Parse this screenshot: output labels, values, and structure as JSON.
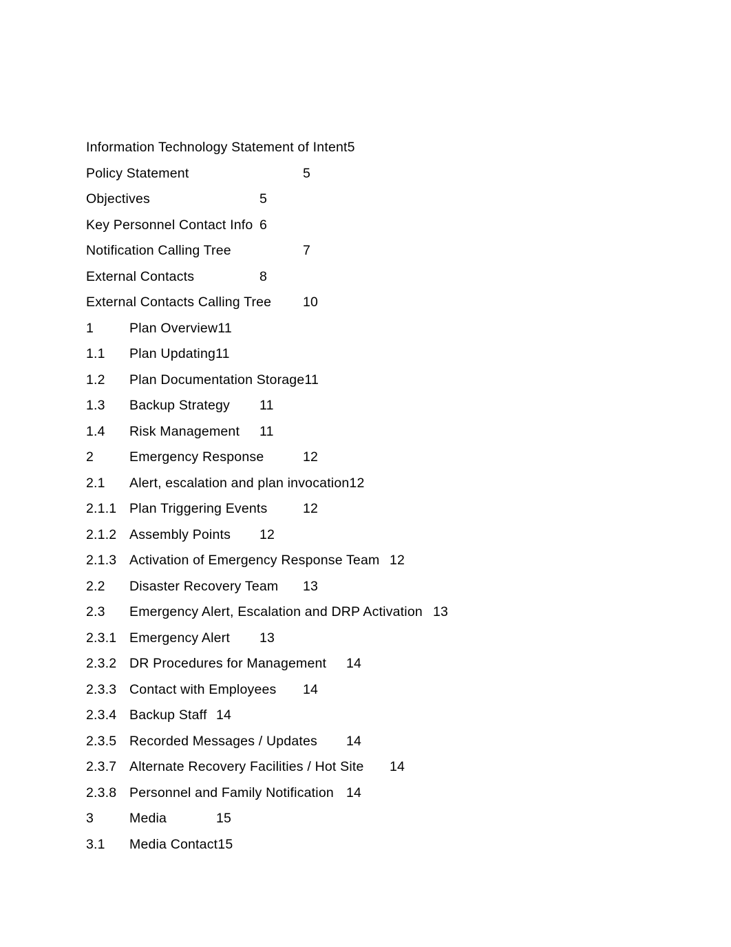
{
  "document": {
    "kind": "table-of-contents",
    "text_color": "#000000",
    "background_color": "#ffffff"
  },
  "toc": {
    "entries": [
      {
        "number": "",
        "title": "Information Technology Statement of Intent",
        "page": "5",
        "stop": "t6"
      },
      {
        "number": "",
        "title": "Policy Statement",
        "page": "5",
        "stop": "t5"
      },
      {
        "number": "",
        "title": "Objectives",
        "page": "5",
        "stop": "t4"
      },
      {
        "number": "",
        "title": "Key Personnel Contact Info",
        "page": "6",
        "stop": "t4"
      },
      {
        "number": "",
        "title": "Notification Calling Tree",
        "page": "7",
        "stop": "t5"
      },
      {
        "number": "",
        "title": "External Contacts",
        "page": "8",
        "stop": "t4"
      },
      {
        "number": "",
        "title": "External Contacts Calling Tree",
        "page": "10",
        "stop": "t5"
      },
      {
        "number": "1",
        "title": "Plan Overview",
        "page": "11",
        "stop": "t0"
      },
      {
        "number": "1.1",
        "title": "Plan Updating",
        "page": "11",
        "stop": "t0"
      },
      {
        "number": "1.2",
        "title": "Plan Documentation Storage",
        "page": "11",
        "stop": "t0"
      },
      {
        "number": "1.3",
        "title": "Backup Strategy",
        "page": "11",
        "stop": "t3"
      },
      {
        "number": "1.4",
        "title": "Risk Management",
        "page": "11",
        "stop": "t3"
      },
      {
        "number": "2",
        "title": "Emergency Response",
        "page": "12",
        "stop": "t4"
      },
      {
        "number": "2.1",
        "title": "Alert, escalation and plan invocation",
        "page": "12",
        "stop": "t0"
      },
      {
        "number": "2.1.1",
        "title": "Plan Triggering Events",
        "page": "12",
        "stop": "t4"
      },
      {
        "number": "2.1.2",
        "title": "Assembly Points",
        "page": "12",
        "stop": "t3"
      },
      {
        "number": "2.1.3",
        "title": "Activation of Emergency Response Team",
        "page": "12",
        "stop": "t6"
      },
      {
        "number": "2.2",
        "title": "Disaster Recovery Team",
        "page": "13",
        "stop": "t4"
      },
      {
        "number": "2.3",
        "title": "Emergency Alert, Escalation and DRP Activation",
        "page": "13",
        "stop": "t7"
      },
      {
        "number": "2.3.1",
        "title": "Emergency Alert",
        "page": "13",
        "stop": "t3"
      },
      {
        "number": "2.3.2",
        "title": "DR Procedures for Management",
        "page": "14",
        "stop": "t5"
      },
      {
        "number": "2.3.3",
        "title": "Contact with Employees",
        "page": "14",
        "stop": "t4"
      },
      {
        "number": "2.3.4",
        "title": "Backup Staff",
        "page": "14",
        "stop": "t2"
      },
      {
        "number": "2.3.5",
        "title": "Recorded Messages / Updates",
        "page": "14",
        "stop": "t5"
      },
      {
        "number": "2.3.7",
        "title": "Alternate Recovery Facilities / Hot Site",
        "page": "14",
        "stop": "t6"
      },
      {
        "number": "2.3.8",
        "title": "Personnel and Family Notification",
        "page": "14",
        "stop": "t5"
      },
      {
        "number": "3",
        "title": "Media",
        "page": "15",
        "stop": "t2"
      },
      {
        "number": "3.1",
        "title": "Media Contact",
        "page": "15",
        "stop": "t0"
      }
    ]
  }
}
